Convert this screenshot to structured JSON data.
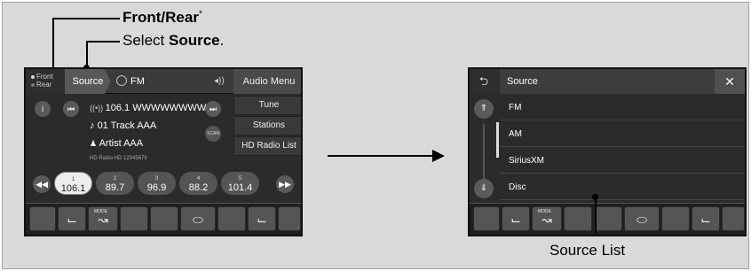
{
  "callouts": {
    "front_rear": {
      "label": "Front/Rear",
      "footnote": "*"
    },
    "select_source": {
      "prefix": "Select ",
      "bold": "Source",
      "suffix": "."
    },
    "source_list": "Source List"
  },
  "left_screen": {
    "front_rear_toggle": {
      "front": "Front",
      "rear": "Rear"
    },
    "source_button": "Source",
    "band": "FM",
    "audio_menu": "Audio Menu",
    "menu_items": [
      "Tune",
      "Stations",
      "HD Radio List"
    ],
    "station_line": "106.1 WWWWWWWW",
    "track_line": "01 Track AAA",
    "artist_line": "Artist AAA",
    "hd_line": "HD Radio   HD 12345678",
    "scan_label": "SCAN",
    "presets": [
      {
        "num": "1",
        "freq": "106.1"
      },
      {
        "num": "2",
        "freq": "89.7"
      },
      {
        "num": "3",
        "freq": "96.9"
      },
      {
        "num": "4",
        "freq": "88.2"
      },
      {
        "num": "5",
        "freq": "101.4"
      }
    ],
    "hvac_mode_label": "MODE"
  },
  "right_screen": {
    "title": "Source",
    "close": "✕",
    "back": "⮌",
    "items": [
      "FM",
      "AM",
      "SiriusXM",
      "Disc"
    ],
    "hvac_mode_label": "MODE"
  },
  "colors": {
    "screen_bg": "#2b2b2b",
    "page_bg": "#d9d9d9",
    "callout": "#000000"
  }
}
